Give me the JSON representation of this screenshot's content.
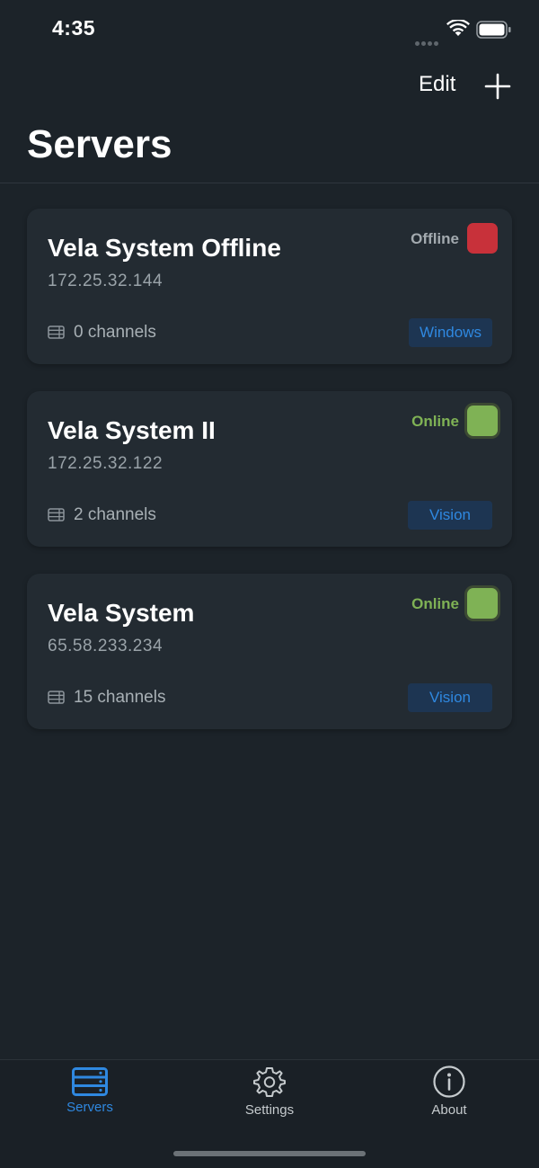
{
  "status_bar": {
    "time": "4:35"
  },
  "nav": {
    "edit_label": "Edit",
    "add_icon": "plus-icon"
  },
  "page": {
    "title": "Servers"
  },
  "servers": [
    {
      "name": "Vela System Offline",
      "ip": "172.25.32.144",
      "status": "Offline",
      "status_color": "#c8313a",
      "status_text_color": "#a3aaaf",
      "channels": "0 channels",
      "os": "Windows"
    },
    {
      "name": "Vela System II",
      "ip": "172.25.32.122",
      "status": "Online",
      "status_color": "#7fb255",
      "status_text_color": "#7fb255",
      "channels": "2 channels",
      "os": "Vision"
    },
    {
      "name": "Vela System",
      "ip": "65.58.233.234",
      "status": "Online",
      "status_color": "#7fb255",
      "status_text_color": "#7fb255",
      "channels": "15 channels",
      "os": "Vision"
    }
  ],
  "tab_bar": {
    "active_color": "#2f88e0",
    "tabs": [
      {
        "label": "Servers",
        "icon": "server-icon",
        "active": true
      },
      {
        "label": "Settings",
        "icon": "gear-icon",
        "active": false
      },
      {
        "label": "About",
        "icon": "info-icon",
        "active": false
      }
    ]
  }
}
